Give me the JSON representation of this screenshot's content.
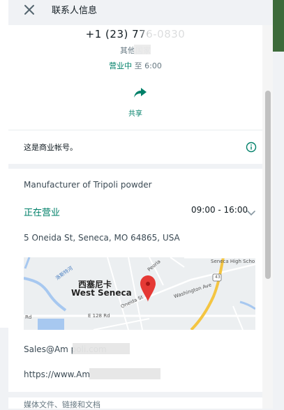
{
  "header": {
    "title": "联系人信息",
    "close_icon": "close-icon"
  },
  "profile": {
    "phone": "+1 (23) 776-0830",
    "region": "其他国家",
    "status_open": "营业中",
    "status_until": "至 6:00",
    "share_label": "共享",
    "share_icon": "share-arrow-icon"
  },
  "business_notice": {
    "text": "这是商业帐号。",
    "icon": "info-icon"
  },
  "details": {
    "description": "Manufacturer of Tripoli powder",
    "open_status": "正在营业",
    "hours": "09:00 - 16:00",
    "address": "5 Oneida St, Seneca, MO 64865, USA",
    "email": "Sales@Am poli.com",
    "website": "https://www.Am",
    "media_title": "媒体文件、链接和文档"
  },
  "map": {
    "city_cn": "西塞尼卡",
    "city_en": "West Seneca",
    "labels": {
      "street1": "Washington Ave",
      "street2": "E 128 Rd",
      "street3": "Oneida St",
      "route": "43",
      "road_left": "Rd",
      "river": "洛斯特河",
      "north_label": "Seneca High Scho",
      "street4": "Peoria"
    }
  },
  "colors": {
    "accent_green": "#008069",
    "pin_red": "#e53935",
    "panel_bg": "#f0f2f5"
  }
}
